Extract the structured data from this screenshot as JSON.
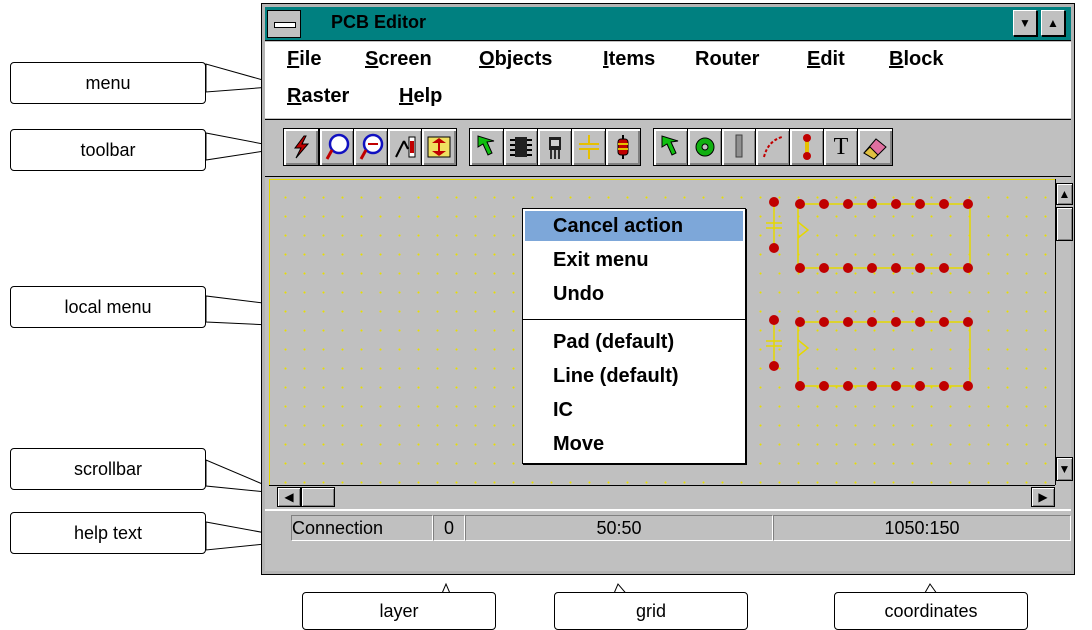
{
  "window": {
    "title": "PCB Editor",
    "minimize_glyph": "▼",
    "maximize_glyph": "▲"
  },
  "menu": [
    {
      "first": "F",
      "rest": "ile"
    },
    {
      "first": "S",
      "rest": "creen"
    },
    {
      "first": "O",
      "rest": "bjects"
    },
    {
      "first": "I",
      "rest": "tems"
    },
    {
      "first": "",
      "rest": "Router"
    },
    {
      "first": "E",
      "rest": "dit"
    },
    {
      "first": "B",
      "rest": "lock"
    },
    {
      "first": "R",
      "rest": "aster"
    },
    {
      "first": "H",
      "rest": "elp"
    }
  ],
  "toolbar": {
    "buttons": [
      {
        "icon": "lightning-icon"
      },
      {
        "icon": "zoom-in-icon"
      },
      {
        "icon": "zoom-out-icon"
      },
      {
        "icon": "redraw-icon"
      },
      {
        "icon": "layers-icon"
      },
      {
        "icon": "select-arrow-icon"
      },
      {
        "icon": "ic-chip-icon"
      },
      {
        "icon": "transistor-icon"
      },
      {
        "icon": "capacitor-icon"
      },
      {
        "icon": "resistor-icon"
      },
      {
        "icon": "select-arrow-icon"
      },
      {
        "icon": "pad-icon"
      },
      {
        "icon": "line-icon"
      },
      {
        "icon": "arc-icon"
      },
      {
        "icon": "via-icon"
      },
      {
        "icon": "text-icon"
      },
      {
        "icon": "eraser-icon"
      }
    ],
    "text_glyph": "T"
  },
  "context_menu": {
    "items": [
      "Cancel action",
      "Exit menu",
      "Undo",
      "Pad (default)",
      "Line (default)",
      "IC",
      "Move"
    ],
    "active_index": 0
  },
  "statusbar": {
    "help_text": "Connection",
    "layer": "0",
    "grid": "50:50",
    "coordinates": "1050:150"
  },
  "scrollbars": {
    "up": "▲",
    "down": "▼",
    "left": "◀",
    "right": "▶"
  },
  "callouts": {
    "menu": "menu",
    "toolbar": "toolbar",
    "local_menu": "local menu",
    "scrollbar": "scrollbar",
    "help_text": "help text",
    "layer": "layer",
    "grid": "grid",
    "coordinates": "coordinates"
  },
  "colors": {
    "titlebar": "#008080",
    "pcb_pad": "#c00000",
    "pcb_trace": "#e6d800",
    "highlight": "#7da7d9"
  }
}
